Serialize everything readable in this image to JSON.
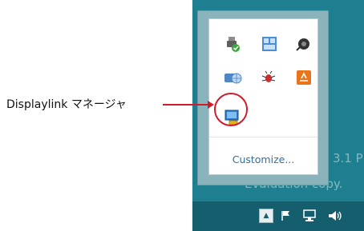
{
  "callout": {
    "label": "Displaylink マネージャ",
    "color": "#d11b2b"
  },
  "tray_flyout": {
    "icons": [
      {
        "name": "usb-device-check-icon"
      },
      {
        "name": "remote-app-icon"
      },
      {
        "name": "sound-mixer-icon"
      },
      {
        "name": "network-globe-icon"
      },
      {
        "name": "red-bug-icon"
      },
      {
        "name": "update-orange-icon"
      },
      {
        "name": "displaylink-manager-icon"
      }
    ],
    "customize_label": "Customize..."
  },
  "desktop": {
    "watermark_version": "3.1 P",
    "watermark_eval": "Evaluation copy."
  },
  "taskbar": {
    "show_hidden": "▲",
    "icons": [
      "action-center-flag-icon",
      "network-icon",
      "volume-icon"
    ]
  },
  "colors": {
    "desktop": "#1d7f8f",
    "taskbar": "#155e6d",
    "link": "#2c6fa7"
  }
}
